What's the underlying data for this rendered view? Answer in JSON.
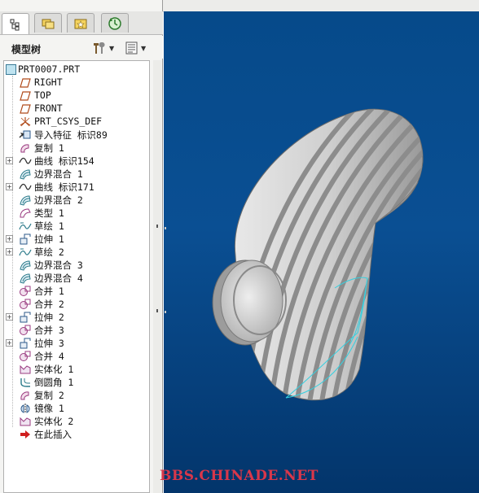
{
  "tabs": [
    {
      "icon": "model-tree-icon"
    },
    {
      "icon": "folder-browser-icon"
    },
    {
      "icon": "favorites-folder-icon"
    },
    {
      "icon": "history-icon"
    }
  ],
  "panel": {
    "title": "模型树"
  },
  "tree": {
    "root": "PRT0007.PRT",
    "items": [
      {
        "label": "RIGHT",
        "icon": "datum-plane-icon",
        "expandable": false
      },
      {
        "label": "TOP",
        "icon": "datum-plane-icon",
        "expandable": false
      },
      {
        "label": "FRONT",
        "icon": "datum-plane-icon",
        "expandable": false
      },
      {
        "label": "PRT_CSYS_DEF",
        "icon": "coordinate-system-icon",
        "expandable": false
      },
      {
        "label": "导入特征 标识89",
        "icon": "import-feature-icon",
        "expandable": false
      },
      {
        "label": "复制 1",
        "icon": "copy-icon",
        "expandable": false
      },
      {
        "label": "曲线 标识154",
        "icon": "curve-icon",
        "expandable": true
      },
      {
        "label": "边界混合 1",
        "icon": "boundary-blend-icon",
        "expandable": false
      },
      {
        "label": "曲线 标识171",
        "icon": "curve-icon",
        "expandable": true
      },
      {
        "label": "边界混合 2",
        "icon": "boundary-blend-icon",
        "expandable": false
      },
      {
        "label": "类型 1",
        "icon": "type-icon",
        "expandable": false
      },
      {
        "label": "草绘 1",
        "icon": "sketch-icon",
        "expandable": false
      },
      {
        "label": "拉伸 1",
        "icon": "extrude-icon",
        "expandable": true
      },
      {
        "label": "草绘 2",
        "icon": "sketch-icon",
        "expandable": true
      },
      {
        "label": "边界混合 3",
        "icon": "boundary-blend-icon",
        "expandable": false
      },
      {
        "label": "边界混合 4",
        "icon": "boundary-blend-icon",
        "expandable": false
      },
      {
        "label": "合并 1",
        "icon": "merge-icon",
        "expandable": false
      },
      {
        "label": "合并 2",
        "icon": "merge-icon",
        "expandable": false
      },
      {
        "label": "拉伸 2",
        "icon": "extrude-icon",
        "expandable": true
      },
      {
        "label": "合并 3",
        "icon": "merge-icon",
        "expandable": false
      },
      {
        "label": "拉伸 3",
        "icon": "extrude-icon",
        "expandable": true
      },
      {
        "label": "合并 4",
        "icon": "merge-icon",
        "expandable": false
      },
      {
        "label": "实体化 1",
        "icon": "solidify-icon",
        "expandable": false
      },
      {
        "label": "倒圆角 1",
        "icon": "round-icon",
        "expandable": false
      },
      {
        "label": "复制 2",
        "icon": "copy-icon",
        "expandable": false
      },
      {
        "label": "镜像 1",
        "icon": "mirror-icon",
        "expandable": false
      },
      {
        "label": "实体化 2",
        "icon": "solidify-icon",
        "expandable": false
      },
      {
        "label": "在此插入",
        "icon": "insert-here-arrow-icon",
        "expandable": false
      }
    ]
  },
  "watermark": "BBS.CHINADE.NET",
  "colors": {
    "viewport_bg": "#064a8a",
    "watermark": "#d9374a",
    "edge_highlight": "#35d0e0"
  }
}
